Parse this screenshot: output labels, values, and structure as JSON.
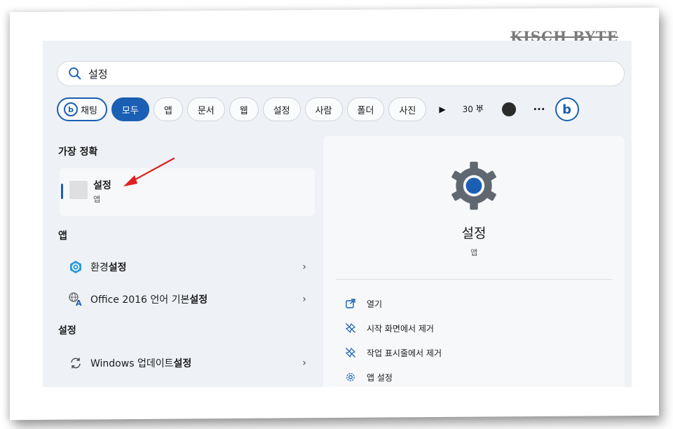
{
  "watermark": "KISCH BYTE",
  "search": {
    "value": "설정"
  },
  "chips": {
    "chat": "채팅",
    "items": [
      "모두",
      "앱",
      "문서",
      "웹",
      "설정",
      "사람",
      "폴더",
      "사진"
    ],
    "points": "30"
  },
  "left": {
    "best_match_header": "가장 정확",
    "best_match": {
      "name": "설정",
      "kind": "앱"
    },
    "apps_header": "앱",
    "apps": [
      {
        "label_plain": "환경 ",
        "label_bold": "설정"
      },
      {
        "label_plain": "Office 2016 언어 기본 ",
        "label_bold": "설정"
      }
    ],
    "settings_header": "설정",
    "settings": [
      {
        "label_plain": "Windows 업데이트 ",
        "label_bold": "설정"
      }
    ]
  },
  "detail": {
    "title": "설정",
    "kind": "앱",
    "actions": [
      "열기",
      "시작 화면에서 제거",
      "작업 표시줄에서 제거",
      "앱 설정"
    ]
  },
  "colors": {
    "accent": "#1a5fb4",
    "annotation": "#e02020"
  }
}
